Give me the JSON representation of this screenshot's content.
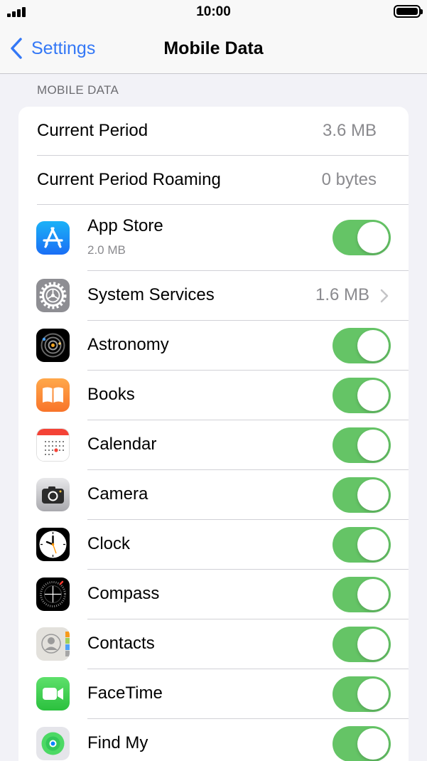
{
  "status_bar": {
    "time": "10:00"
  },
  "nav": {
    "back_label": "Settings",
    "title": "Mobile Data"
  },
  "section": {
    "header": "MOBILE DATA"
  },
  "usage": {
    "current_period_label": "Current Period",
    "current_period_value": "3.6 MB",
    "roaming_label": "Current Period Roaming",
    "roaming_value": "0 bytes"
  },
  "apps": [
    {
      "label": "App Store",
      "sublabel": "2.0 MB",
      "icon": "app-store-icon",
      "enabled": true
    },
    {
      "label": "System Services",
      "value": "1.6 MB",
      "icon": "gear-icon"
    },
    {
      "label": "Astronomy",
      "icon": "astronomy-icon",
      "enabled": true
    },
    {
      "label": "Books",
      "icon": "books-icon",
      "enabled": true
    },
    {
      "label": "Calendar",
      "icon": "calendar-icon",
      "enabled": true
    },
    {
      "label": "Camera",
      "icon": "camera-icon",
      "enabled": true
    },
    {
      "label": "Clock",
      "icon": "clock-icon",
      "enabled": true
    },
    {
      "label": "Compass",
      "icon": "compass-icon",
      "enabled": true
    },
    {
      "label": "Contacts",
      "icon": "contacts-icon",
      "enabled": true
    },
    {
      "label": "FaceTime",
      "icon": "facetime-icon",
      "enabled": true
    },
    {
      "label": "Find My",
      "icon": "find-my-icon",
      "enabled": true
    }
  ],
  "colors": {
    "accent": "#3478f6",
    "toggle_on": "#65c466",
    "background": "#f2f2f7",
    "secondary_text": "#8a8a8e"
  }
}
